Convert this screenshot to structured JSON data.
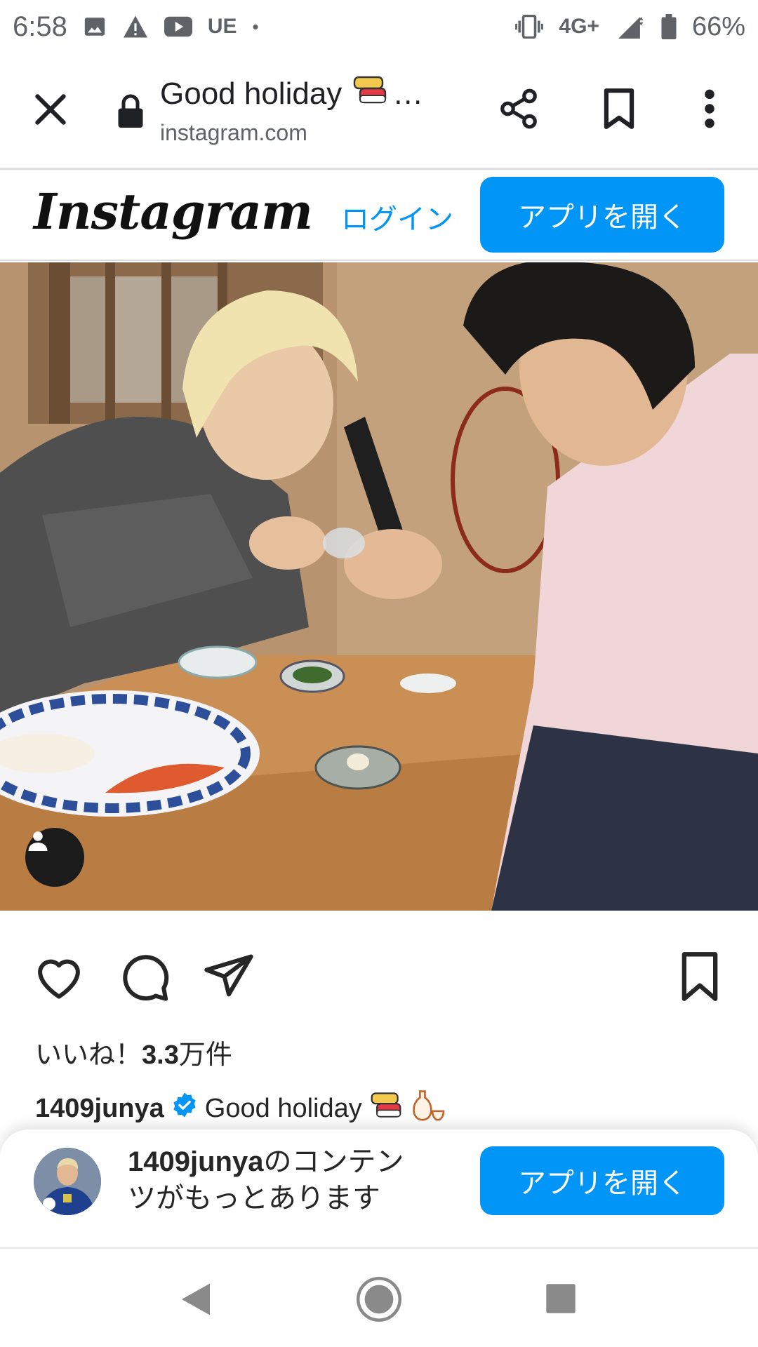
{
  "status_bar": {
    "time": "6:58",
    "carrier_label": "UE",
    "dot": "•",
    "network": "4G+",
    "battery": "66%",
    "icons": [
      "image-icon",
      "warning-icon",
      "youtube-icon",
      "vibrate-icon",
      "signal-icon",
      "battery-icon"
    ]
  },
  "toolbar": {
    "title": "Good holiday",
    "title_ellipsis": "…",
    "url": "instagram.com",
    "icons": [
      "close-icon",
      "lock-icon",
      "share-icon",
      "bookmark-icon",
      "more-vert-icon"
    ]
  },
  "header": {
    "logo": "Instagram",
    "login_label": "ログイン",
    "open_app_label": "アプリを開く"
  },
  "post": {
    "likes_prefix": "いいね！",
    "likes_count": "3.3",
    "likes_suffix": "万件",
    "username": "1409junya",
    "caption": "Good holiday"
  },
  "sheet": {
    "username": "1409junya",
    "text": "のコンテンツがもっとあります",
    "open_app_label": "アプリを開く"
  },
  "colors": {
    "accent": "#0095f6",
    "text": "#262626",
    "status": "#5f6368"
  }
}
